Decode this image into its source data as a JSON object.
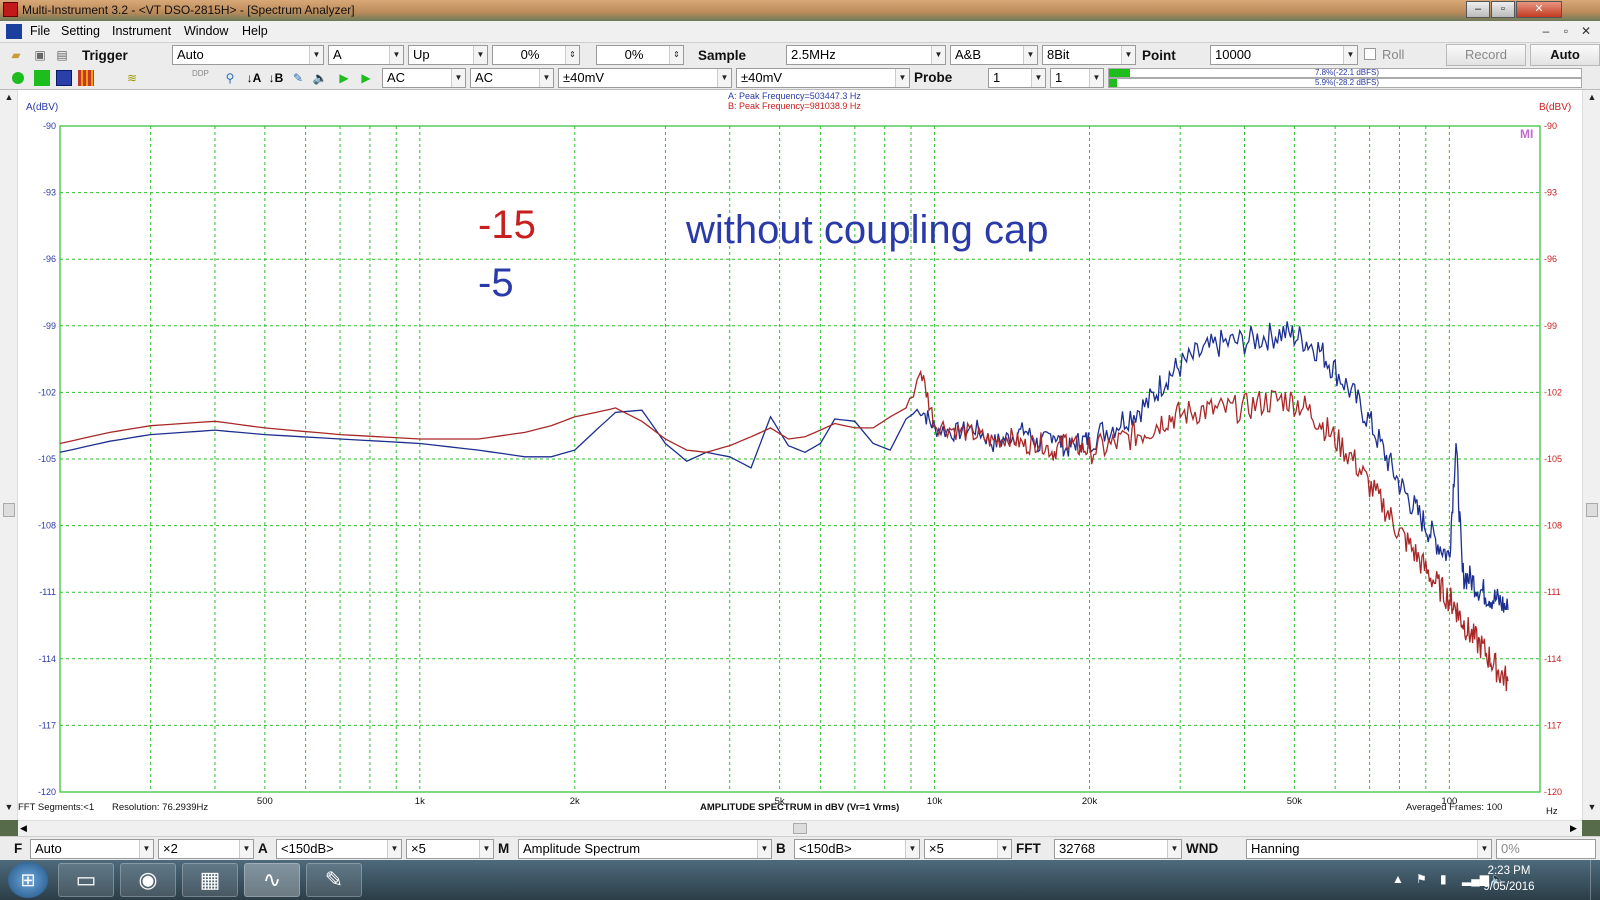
{
  "window": {
    "title": "Multi-Instrument 3.2   - <VT DSO-2815H> - [Spectrum Analyzer]",
    "min_icon": "minimize-icon",
    "max_icon": "maximize-icon",
    "close_icon": "close-icon"
  },
  "menu": {
    "items": [
      "File",
      "Setting",
      "Instrument",
      "Window",
      "Help"
    ],
    "mdi": [
      "–",
      "▫",
      "✕"
    ]
  },
  "toolbar1": {
    "trigger_label": "Trigger",
    "trigger_mode": "Auto",
    "channel": "A",
    "edge": "Up",
    "level": "0%",
    "pretrigger": "0%",
    "sample_label": "Sample",
    "sample_rate": "2.5MHz",
    "channels": "A&B",
    "bits": "8Bit",
    "point_label": "Point",
    "points": "10000",
    "roll_label": "Roll",
    "record_label": "Record",
    "auto_label": "Auto"
  },
  "toolbar2": {
    "coupling_a": "AC",
    "coupling_b": "AC",
    "range_a": "±40mV",
    "range_b": "±40mV",
    "probe_label": "Probe",
    "probe_a": "1",
    "probe_b": "1",
    "level_a": "7.8%(-22.1 dBFS)",
    "level_b": "5.9%(-28.2 dBFS)",
    "level_a_fill": 0.56,
    "level_b_fill": 0.2,
    "icons": [
      "run-icon",
      "stop-icon",
      "oscilloscope-icon",
      "analyzer-icon",
      "generator-icon",
      "ddp-icon",
      "probe-icon",
      "cursor-a-icon",
      "cursor-b-icon",
      "marker-icon",
      "speaker-icon",
      "play-icon",
      "play-single-icon"
    ]
  },
  "plot": {
    "ylabel_a": "A(dBV)",
    "ylabel_b": "B(dBV)",
    "peak_a": "A: Peak Frequency=503447.3 Hz",
    "peak_b": "B: Peak Frequency=981038.9 Hz",
    "watermark": "MI",
    "annotation_red": "-15",
    "annotation_blue": "-5",
    "annotation_text": "without coupling cap",
    "annotation_red_color": "#c81e1e",
    "annotation_blue_color": "#2a3aa8",
    "footer_left": "FFT  Segments:<1",
    "footer_resolution": "Resolution: 76.2939Hz",
    "footer_center": "AMPLITUDE SPECTRUM in dBV (Vr=1 Vrms)",
    "footer_frames": "Averaged Frames: 100",
    "footer_unit": "Hz"
  },
  "chart_data": {
    "type": "line",
    "title": "",
    "xlabel": "AMPLITUDE SPECTRUM in dBV (Vr=1 Vrms)",
    "ylabel": "A(dBV)",
    "ylabel_right": "B(dBV)",
    "x_scale": "log",
    "xlim": [
      200,
      150000
    ],
    "ylim": [
      -120,
      -90
    ],
    "grid": true,
    "grid_color": "#2fbf2f",
    "y_ticks": [
      -90,
      -93,
      -96,
      -99,
      -102,
      -105,
      -108,
      -111,
      -114,
      -117,
      -120
    ],
    "x_ticks": [
      {
        "value": 500,
        "label": "500"
      },
      {
        "value": 1000,
        "label": "1k"
      },
      {
        "value": 2000,
        "label": "2k"
      },
      {
        "value": 5000,
        "label": "5k"
      },
      {
        "value": 10000,
        "label": "10k"
      },
      {
        "value": 20000,
        "label": "20k"
      },
      {
        "value": 50000,
        "label": "50k"
      },
      {
        "value": 100000,
        "label": "100"
      }
    ],
    "series": [
      {
        "name": "A",
        "color": "#1d2f8f",
        "x": [
          200,
          250,
          300,
          400,
          500,
          700,
          1000,
          1300,
          1600,
          1800,
          2000,
          2200,
          2400,
          2700,
          3000,
          3300,
          3600,
          4000,
          4400,
          4800,
          5200,
          5600,
          6000,
          6400,
          7000,
          7600,
          8200,
          8800,
          9400,
          10000,
          11000,
          12000,
          13000,
          14000,
          15000,
          16000,
          17000,
          18000,
          19000,
          20000,
          22000,
          24000,
          26000,
          28000,
          30000,
          33000,
          36000,
          40000,
          44000,
          48000,
          52000,
          56000,
          60000,
          65000,
          70000,
          75000,
          80000,
          85000,
          90000,
          95000,
          100000,
          103000,
          106000,
          110000,
          115000,
          120000,
          125000,
          130000
        ],
        "y": [
          -104.7,
          -104.2,
          -103.9,
          -103.7,
          -103.9,
          -104.1,
          -104.3,
          -104.6,
          -104.9,
          -104.9,
          -104.6,
          -103.7,
          -102.9,
          -102.8,
          -104.3,
          -105.1,
          -104.7,
          -104.9,
          -105.4,
          -103.1,
          -104.4,
          -104.7,
          -104.3,
          -103.2,
          -103.3,
          -104.3,
          -104.6,
          -103.2,
          -102.7,
          -103.6,
          -103.8,
          -103.6,
          -104.3,
          -104.0,
          -103.7,
          -104.4,
          -103.8,
          -104.6,
          -104.2,
          -104.1,
          -103.6,
          -103.0,
          -102.5,
          -101.4,
          -100.8,
          -100.2,
          -99.8,
          -99.7,
          -99.5,
          -99.3,
          -99.6,
          -100.1,
          -101.0,
          -102.1,
          -103.3,
          -104.8,
          -106.1,
          -107.1,
          -108.0,
          -108.8,
          -109.4,
          -104.2,
          -110.2,
          -110.4,
          -110.9,
          -111.2,
          -111.4,
          -111.8
        ]
      },
      {
        "name": "B",
        "color": "#a82828",
        "x": [
          200,
          250,
          300,
          400,
          500,
          700,
          1000,
          1300,
          1600,
          1800,
          2000,
          2200,
          2400,
          2700,
          3000,
          3300,
          3600,
          4000,
          4400,
          4800,
          5200,
          5600,
          6000,
          6400,
          7000,
          7600,
          8200,
          8800,
          9400,
          10000,
          11000,
          12000,
          13000,
          14000,
          15000,
          16000,
          17000,
          18000,
          19000,
          20000,
          22000,
          24000,
          26000,
          28000,
          30000,
          33000,
          36000,
          40000,
          44000,
          48000,
          52000,
          56000,
          60000,
          65000,
          70000,
          75000,
          80000,
          85000,
          90000,
          95000,
          100000,
          103000,
          106000,
          110000,
          115000,
          120000,
          125000,
          130000
        ],
        "y": [
          -104.3,
          -103.8,
          -103.5,
          -103.3,
          -103.6,
          -103.9,
          -104.1,
          -104.1,
          -103.8,
          -103.5,
          -103.1,
          -102.9,
          -102.7,
          -103.3,
          -104.1,
          -104.6,
          -104.7,
          -104.4,
          -104.0,
          -103.6,
          -104.1,
          -104.0,
          -103.7,
          -103.4,
          -103.6,
          -103.6,
          -103.1,
          -102.7,
          -101.0,
          -103.4,
          -103.7,
          -103.9,
          -104.2,
          -104.0,
          -104.4,
          -104.2,
          -104.7,
          -104.1,
          -104.5,
          -104.6,
          -104.4,
          -104.0,
          -103.7,
          -103.2,
          -103.0,
          -102.8,
          -102.8,
          -102.7,
          -102.4,
          -102.3,
          -102.6,
          -103.3,
          -104.1,
          -105.0,
          -106.2,
          -107.2,
          -108.3,
          -109.1,
          -110.0,
          -110.7,
          -111.3,
          -111.7,
          -112.3,
          -112.9,
          -113.4,
          -114.0,
          -114.6,
          -115.0
        ]
      }
    ]
  },
  "bottom": {
    "f_label": "F",
    "f_mode": "Auto",
    "zoom": "×2",
    "a_label": "A",
    "a_range": "<150dB>",
    "a_scale": "×5",
    "m_label": "M",
    "mode": "Amplitude Spectrum",
    "b_label": "B",
    "b_range": "<150dB>",
    "b_scale": "×5",
    "fft_label": "FFT",
    "fft_size": "32768",
    "wnd_label": "WND",
    "window": "Hanning",
    "overlap": "0%"
  },
  "taskbar": {
    "start_icon": "windows-start-icon",
    "apps": [
      "explorer-icon",
      "chrome-icon",
      "photos-icon",
      "multi-instrument-icon",
      "paint-icon"
    ],
    "time": "2:23 PM",
    "date": "9/05/2016"
  }
}
